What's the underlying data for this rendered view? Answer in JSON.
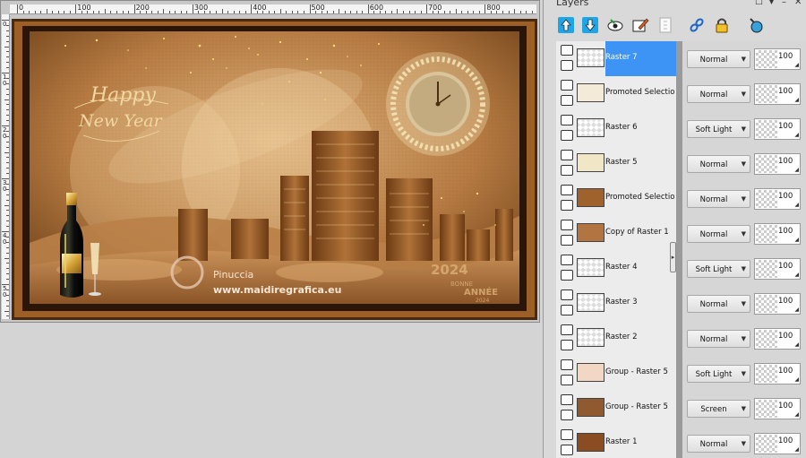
{
  "palette": {
    "title": "Layers"
  },
  "ruler": {
    "top_labels": [
      "0",
      "100",
      "200",
      "300",
      "400",
      "500",
      "600",
      "700",
      "800",
      "900"
    ],
    "left_labels": [
      "0",
      "1 0",
      "2 0",
      "3 0",
      "4 0",
      "5 0"
    ]
  },
  "canvas": {
    "greeting_line1": "Happy",
    "greeting_line2": "New Year",
    "watermark_name": "Pinuccia",
    "watermark_url": "www.maidiregrafica.eu",
    "year_text": "2024",
    "word_bonne": "BONNE",
    "word_annee": "ANNÉE",
    "small_year": "2024"
  },
  "layers": [
    {
      "name": "Raster 7",
      "blend": "Normal",
      "opacity": "100",
      "selected": true,
      "thumb": "#ffffff"
    },
    {
      "name": "Promoted Selection",
      "blend": "Normal",
      "opacity": "100",
      "selected": false,
      "thumb": "#f4ead8"
    },
    {
      "name": "Raster 6",
      "blend": "Soft Light",
      "opacity": "100",
      "selected": false,
      "thumb": "#ffffff"
    },
    {
      "name": "Raster 5",
      "blend": "Normal",
      "opacity": "100",
      "selected": false,
      "thumb": "#f1e6c6"
    },
    {
      "name": "Promoted Selection",
      "blend": "Normal",
      "opacity": "100",
      "selected": false,
      "thumb": "#a0622c"
    },
    {
      "name": "Copy of Raster 1",
      "blend": "Normal",
      "opacity": "100",
      "selected": false,
      "thumb": "#b27440"
    },
    {
      "name": "Raster 4",
      "blend": "Soft Light",
      "opacity": "100",
      "selected": false,
      "thumb": "#ffffff"
    },
    {
      "name": "Raster 3",
      "blend": "Normal",
      "opacity": "100",
      "selected": false,
      "thumb": "#ffffff"
    },
    {
      "name": "Raster 2",
      "blend": "Normal",
      "opacity": "100",
      "selected": false,
      "thumb": "#ffffff"
    },
    {
      "name": "Group - Raster 5",
      "blend": "Soft Light",
      "opacity": "100",
      "selected": false,
      "thumb": "#f2d7c4"
    },
    {
      "name": "Group - Raster 5",
      "blend": "Screen",
      "opacity": "100",
      "selected": false,
      "thumb": "#8f5a30"
    },
    {
      "name": "Raster 1",
      "blend": "Normal",
      "opacity": "100",
      "selected": false,
      "thumb": "#8a4d22"
    }
  ],
  "colors": {
    "selection_highlight": "#3d94f5",
    "canvas_frame": "#5a3415",
    "canvas_main": "#c08850"
  }
}
